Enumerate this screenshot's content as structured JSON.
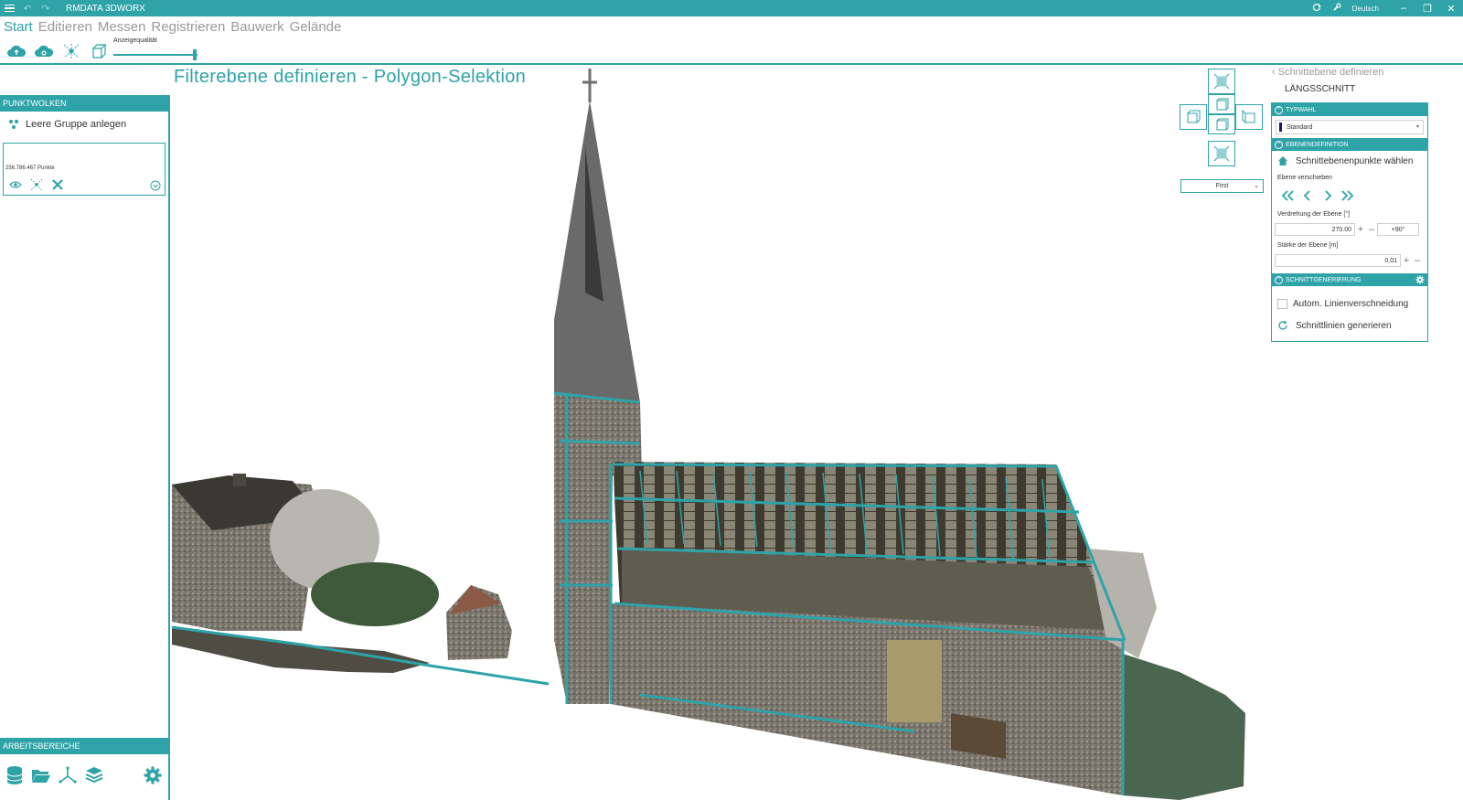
{
  "window": {
    "title": "RMDATA 3DWORX",
    "language": "Deutsch"
  },
  "ribbon": {
    "tabs": [
      {
        "label": "Start",
        "active": true
      },
      {
        "label": "Editieren",
        "active": false
      },
      {
        "label": "Messen",
        "active": false
      },
      {
        "label": "Registrieren",
        "active": false
      },
      {
        "label": "Bauwerk",
        "active": false
      },
      {
        "label": "Gelände",
        "active": false
      }
    ],
    "tools": [
      "cloud-upload-icon",
      "cloud-settings-icon",
      "point-scatter-icon",
      "box-icon"
    ],
    "quality_label": "Anzeigequalität",
    "quality_level": 0.95
  },
  "left_panel": {
    "header": "PUNKTWOLKEN",
    "create_group_label": "Leere Gruppe anlegen",
    "point_count": "256.786.467 Punkte",
    "workspace_header": "ARBEITSBEREICHE",
    "bottom_icons": [
      "database-icon",
      "folder-open-icon",
      "axis-icon",
      "layers-icon",
      "gear-icon"
    ]
  },
  "viewport": {
    "title": "Filterebene  definieren  -  Polygon-Selektion",
    "view_select": "First"
  },
  "right_panel": {
    "back_label": "Schnittebene definieren",
    "subtitle": "LÄNGSSCHNITT",
    "typwahl_header": "TYPWAHL",
    "typ_value": "Standard",
    "ebenen_header": "EBENENDEFINITION",
    "pick_points_label": "Schnittebenenpunkte wählen",
    "move_plane_label": "Ebene verschieben",
    "rotation_label": "Verdrehung der Ebene [°]",
    "rotation_value": "270.00",
    "rotation_step": "+90°",
    "thickness_label": "Stärke der Ebene [m]",
    "thickness_value": "0.01",
    "generation_header": "SCHNITTGENERIERUNG",
    "auto_line_label": "Autom. Linienverschneidung",
    "auto_line_checked": false,
    "generate_label": "Schnittlinien generieren"
  },
  "colors": {
    "accent": "#2ea3a8",
    "muted_text": "#9a9a9a"
  }
}
